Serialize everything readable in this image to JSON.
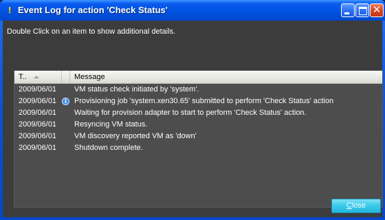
{
  "window": {
    "title": "Event Log for action 'Check Status'"
  },
  "instruction": "Double Click on an item to show additional details.",
  "grid": {
    "columns": [
      "T..",
      "",
      "Message"
    ],
    "rows": [
      {
        "date": "2009/06/01",
        "icon": "",
        "message": "VM status check initiated by 'system'."
      },
      {
        "date": "2009/06/01",
        "icon": "info-icon",
        "message": "Provisioning job 'system.xen30.65' submitted to perform 'Check Status' action"
      },
      {
        "date": "2009/06/01",
        "icon": "",
        "message": "Waiting for provision adapter to start to perform 'Check Status' action."
      },
      {
        "date": "2009/06/01",
        "icon": "",
        "message": "Resyncing VM status."
      },
      {
        "date": "2009/06/01",
        "icon": "",
        "message": "VM discovery reported VM as 'down'"
      },
      {
        "date": "2009/06/01",
        "icon": "",
        "message": "Shutdown complete."
      }
    ]
  },
  "buttons": {
    "close_mnemonic": "C",
    "close_rest": "lose"
  },
  "colors": {
    "titlebar": "#0053e0",
    "client_bg": "#3c3c3c",
    "grid_bg": "#4d4d4d",
    "close_button": "#3ccbec"
  }
}
